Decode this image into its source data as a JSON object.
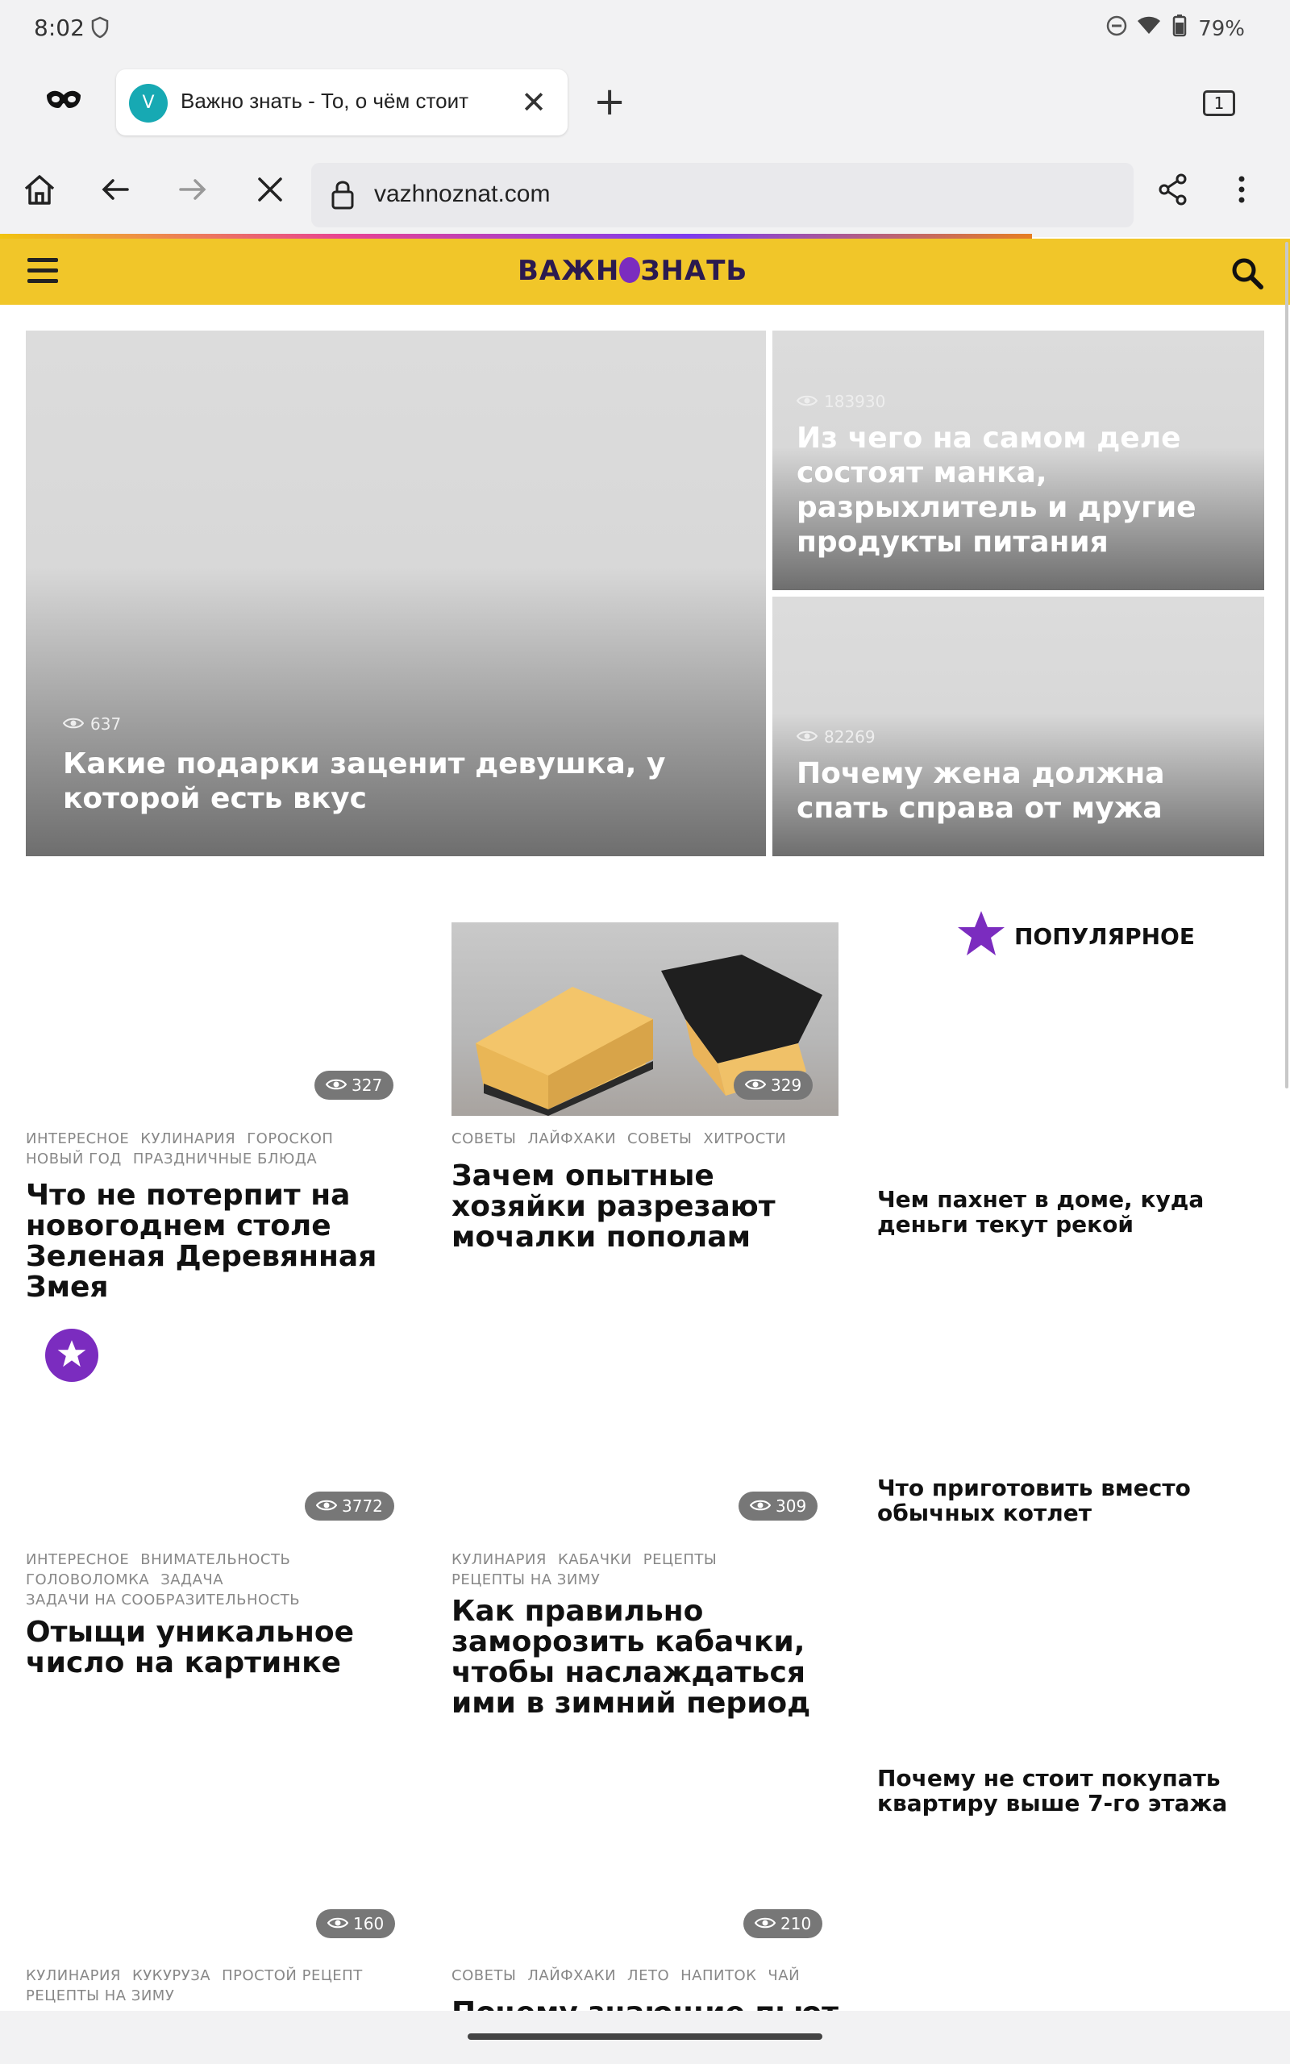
{
  "status": {
    "time": "8:02",
    "battery": "79%"
  },
  "tab": {
    "favicon_letter": "V",
    "title": "Важно знать - То, о чём стоит",
    "count": "1"
  },
  "address": {
    "url": "vazhnoznat.com"
  },
  "site": {
    "logo_left": "ВАЖН",
    "logo_right": "ЗНАТЬ"
  },
  "hero": {
    "main": {
      "views": "637",
      "title": "Какие подарки заценит девушка, у которой есть вкус"
    },
    "top_right": {
      "views": "183930",
      "title": "Из чего на самом деле состоят манка, разрыхлитель и другие продукты питания"
    },
    "bottom_right": {
      "views": "82269",
      "title": "Почему жена должна спать справа от мужа"
    }
  },
  "popular": {
    "label": "ПОПУЛЯРНОЕ",
    "items": [
      "Чем пахнет в доме, куда деньги текут рекой",
      "Что приготовить вместо обычных котлет",
      "Почему не стоит покупать квартиру выше 7-го этажа"
    ]
  },
  "cards": [
    {
      "views": "327",
      "tags_line1": [
        "ИНТЕРЕСНОЕ",
        "КУЛИНАРИЯ",
        "ГОРОСКОП"
      ],
      "tags_line2": [
        "НОВЫЙ ГОД",
        "ПРАЗДНИЧНЫЕ БЛЮДА"
      ],
      "tags_line3": [],
      "title": "Что не потерпит на новогоднем столе Зеленая Деревянная Змея"
    },
    {
      "views": "329",
      "tags_line1": [
        "СОВЕТЫ",
        "ЛАЙФХАКИ",
        "СОВЕТЫ",
        "ХИТРОСТИ"
      ],
      "tags_line2": [],
      "tags_line3": [],
      "title": "Зачем опытные хозяйки разрезают мочалки пополам"
    },
    {
      "views": "3772",
      "tags_line1": [
        "ИНТЕРЕСНОЕ",
        "ВНИМАТЕЛЬНОСТЬ"
      ],
      "tags_line2": [
        "ГОЛОВОЛОМКА",
        "ЗАДАЧА"
      ],
      "tags_line3": [
        "ЗАДАЧИ НА СООБРАЗИТЕЛЬНОСТЬ"
      ],
      "title": "Отыщи уникальное число на картинке"
    },
    {
      "views": "309",
      "tags_line1": [
        "КУЛИНАРИЯ",
        "КАБАЧКИ",
        "РЕЦЕПТЫ"
      ],
      "tags_line2": [
        "РЕЦЕПТЫ НА ЗИМУ"
      ],
      "tags_line3": [],
      "title": "Как правильно заморозить кабачки, чтобы наслаждаться ими в зимний период"
    },
    {
      "views": "160",
      "tags_line1": [
        "КУЛИНАРИЯ",
        "КУКУРУЗА",
        "ПРОСТОЙ РЕЦЕПТ"
      ],
      "tags_line2": [
        "РЕЦЕПТЫ НА ЗИМУ"
      ],
      "tags_line3": [],
      "title": ""
    },
    {
      "views": "210",
      "tags_line1": [
        "СОВЕТЫ",
        "ЛАЙФХАКИ",
        "ЛЕТО",
        "НАПИТОК",
        "ЧАЙ"
      ],
      "tags_line2": [],
      "tags_line3": [],
      "title": "Почему знающие пьют в"
    }
  ]
}
